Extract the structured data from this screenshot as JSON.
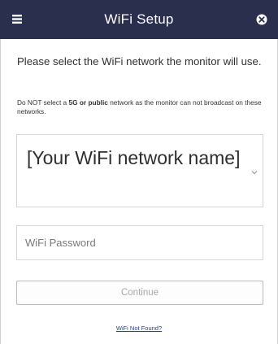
{
  "header": {
    "title": "WiFi Setup",
    "menu_icon": "menu-icon",
    "close_icon": "close-icon",
    "background_color": "#2b2f4e"
  },
  "content": {
    "lead_text": "Please select the WiFi network the monitor will use.",
    "warning_prefix": "Do NOT select a ",
    "warning_bold": "5G or public",
    "warning_suffix": " network as the monitor can not broadcast on these networks.",
    "network_select": {
      "selected_value": "[Your WiFi network name]",
      "caret_icon": "dropdown-caret-icon"
    },
    "password_field": {
      "placeholder": "WiFi Password",
      "value": ""
    },
    "continue_label": "Continue",
    "not_found_link": "WiFi Not Found?"
  }
}
